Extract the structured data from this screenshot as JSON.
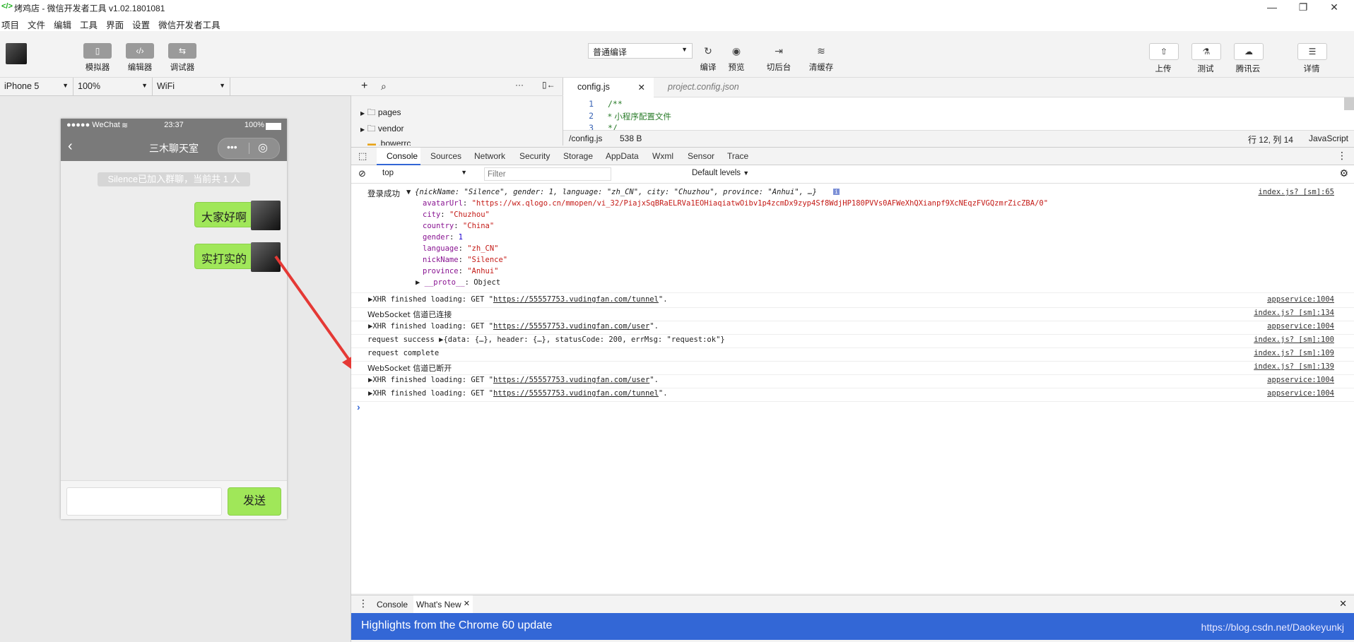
{
  "window": {
    "title": "烤鸡店 - 微信开发者工具 v1.02.1801081",
    "logo": "</>",
    "controls": [
      "minimize-icon",
      "restore-icon",
      "close-icon"
    ]
  },
  "menu": [
    "项目",
    "文件",
    "编辑",
    "工具",
    "界面",
    "设置",
    "微信开发者工具"
  ],
  "toolbar": {
    "left": [
      {
        "label": "模拟器",
        "icon": "phone-icon"
      },
      {
        "label": "编辑器",
        "icon": "code-icon"
      },
      {
        "label": "调试器",
        "icon": "debug-icon"
      }
    ],
    "compile_mode": "普通编译",
    "center": [
      {
        "label": "编译",
        "icon": "refresh-icon"
      },
      {
        "label": "预览",
        "icon": "eye-icon"
      },
      {
        "label": "切后台",
        "icon": "switch-icon"
      },
      {
        "label": "清缓存",
        "icon": "layers-icon"
      }
    ],
    "right": [
      {
        "label": "上传",
        "icon": "upload-icon"
      },
      {
        "label": "测试",
        "icon": "flask-icon"
      },
      {
        "label": "腾讯云",
        "icon": "cloud-icon"
      },
      {
        "label": "详情",
        "icon": "menu-icon"
      }
    ]
  },
  "device": {
    "model": "iPhone 5",
    "zoom": "100%",
    "network": "WiFi"
  },
  "phone": {
    "carrier": "●●●●● WeChat",
    "time": "23:37",
    "battery": "100%",
    "nav_title": "三木聊天室",
    "system_message": "Silence已加入群聊，当前共 1 人",
    "messages": [
      "大家好啊",
      "实打实的"
    ],
    "send_label": "发送"
  },
  "filetree": {
    "items": [
      "pages",
      "vendor",
      ".bowerrc"
    ]
  },
  "editor": {
    "tabs": [
      "config.js",
      "project.config.json"
    ],
    "lines": [
      {
        "n": "1",
        "text": "/**"
      },
      {
        "n": "2",
        "text": " * 小程序配置文件"
      },
      {
        "n": "3",
        "text": " */"
      }
    ],
    "status_path": "/config.js",
    "status_size": "538 B",
    "status_pos": "行 12, 列 14",
    "status_lang": "JavaScript"
  },
  "devtools": {
    "tabs": [
      "Console",
      "Sources",
      "Network",
      "Security",
      "Storage",
      "AppData",
      "Wxml",
      "Sensor",
      "Trace"
    ],
    "context": "top",
    "filter_placeholder": "Filter",
    "levels": "Default levels",
    "login": {
      "label": "登录成功",
      "summary": "{nickName: \"Silence\", gender: 1, language: \"zh_CN\", city: \"Chuzhou\", province: \"Anhui\", …}",
      "source": "index.js? [sm]:65",
      "props": [
        {
          "k": "avatarUrl",
          "v": "\"https://wx.qlogo.cn/mmopen/vi_32/PiajxSqBRaELRVa1EOHiaqiatwOibv1p4zcmDx9zyp4Sf8WdjHP180PVVs0AFWeXhQXianpf9XcNEqzFVGQzmrZicZBA/0\"",
          "t": "str"
        },
        {
          "k": "city",
          "v": "\"Chuzhou\"",
          "t": "str"
        },
        {
          "k": "country",
          "v": "\"China\"",
          "t": "str"
        },
        {
          "k": "gender",
          "v": "1",
          "t": "num"
        },
        {
          "k": "language",
          "v": "\"zh_CN\"",
          "t": "str"
        },
        {
          "k": "nickName",
          "v": "\"Silence\"",
          "t": "str"
        },
        {
          "k": "province",
          "v": "\"Anhui\"",
          "t": "str"
        },
        {
          "k": "__proto__",
          "v": "Object",
          "t": "plain"
        }
      ]
    },
    "rows": [
      {
        "pre": "▶XHR finished loading: GET \"",
        "url": "https://55557753.vudingfan.com/tunnel",
        "post": "\".",
        "src": "appservice:1004"
      },
      {
        "pre": "WebSocket 信道已连接",
        "url": "",
        "post": "",
        "src": "index.js? [sm]:134"
      },
      {
        "pre": "▶XHR finished loading: GET \"",
        "url": "https://55557753.vudingfan.com/user",
        "post": "\".",
        "src": "appservice:1004"
      },
      {
        "pre": "request success ▶{data: {…}, header: {…}, statusCode: 200, errMsg: \"request:ok\"}",
        "url": "",
        "post": "",
        "src": "index.js? [sm]:100"
      },
      {
        "pre": "request complete",
        "url": "",
        "post": "",
        "src": "index.js? [sm]:109"
      },
      {
        "pre": "WebSocket 信道已断开",
        "url": "",
        "post": "",
        "src": "index.js? [sm]:139"
      },
      {
        "pre": "▶XHR finished loading: GET \"",
        "url": "https://55557753.vudingfan.com/user",
        "post": "\".",
        "src": "appservice:1004"
      },
      {
        "pre": "▶XHR finished loading: GET \"",
        "url": "https://55557753.vudingfan.com/tunnel",
        "post": "\".",
        "src": "appservice:1004"
      }
    ],
    "prompt": "›"
  },
  "drawer": {
    "tabs": [
      "Console",
      "What's New"
    ],
    "highlight": "Highlights from the Chrome 60 update",
    "watermark": "https://blog.csdn.net/Daokeyunkj"
  },
  "colors": {
    "bubble": "#a0e759",
    "highlight_bar": "#3367d6",
    "arrow": "#e53935"
  }
}
